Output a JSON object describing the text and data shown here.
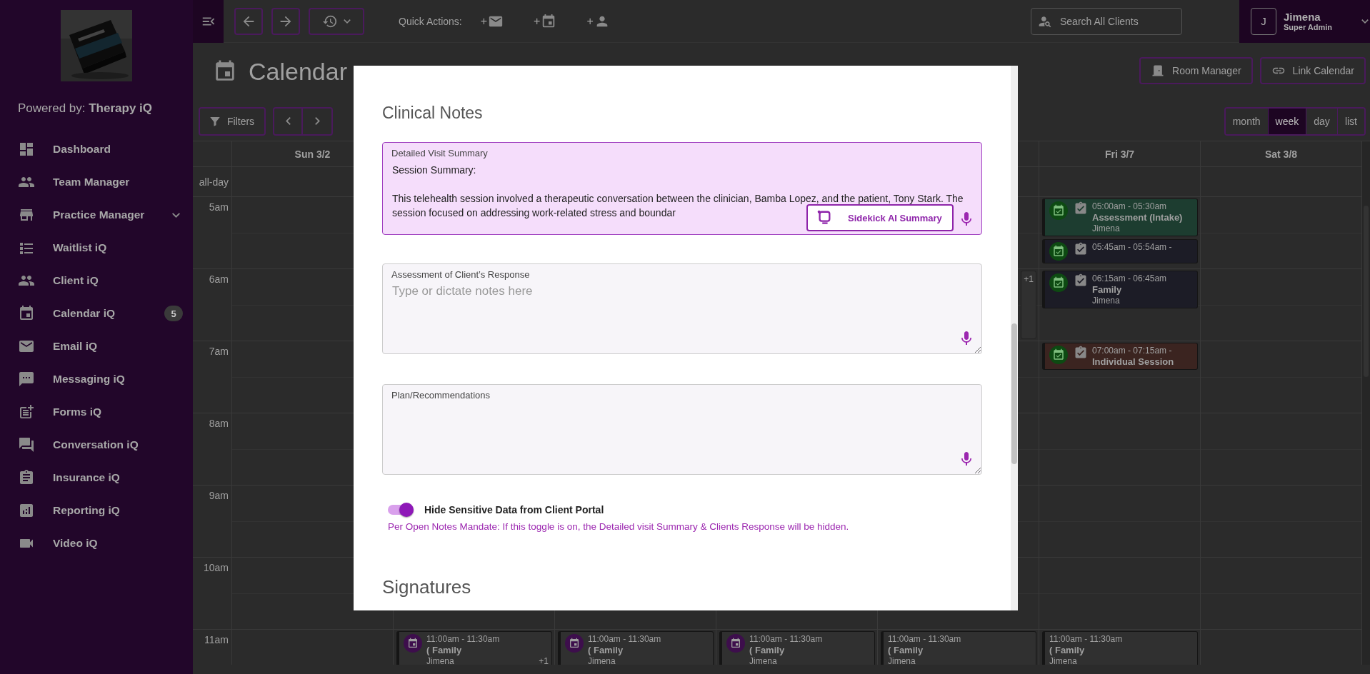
{
  "sidebar": {
    "powered_by": "Powered by: **Therapy iQ**",
    "items": [
      {
        "label": "Dashboard",
        "kind": "link"
      },
      {
        "label": "Team Manager",
        "kind": "link"
      },
      {
        "label": "Practice Manager",
        "kind": "group"
      },
      {
        "label": "Waitlist iQ",
        "kind": "link"
      },
      {
        "label": "Client iQ",
        "kind": "link"
      },
      {
        "label": "Calendar iQ",
        "kind": "link",
        "badge": "5"
      },
      {
        "label": "Email iQ",
        "kind": "link"
      },
      {
        "label": "Messaging iQ",
        "kind": "link"
      },
      {
        "label": "Forms iQ",
        "kind": "link"
      },
      {
        "label": "Conversation iQ",
        "kind": "link"
      },
      {
        "label": "Insurance iQ",
        "kind": "link"
      },
      {
        "label": "Reporting iQ",
        "kind": "link"
      },
      {
        "label": "Video iQ",
        "kind": "link"
      }
    ]
  },
  "topbar": {
    "quick_actions_label": "Quick Actions:",
    "quick_actions": [
      {
        "plus": "+",
        "kind": "email"
      },
      {
        "plus": "+",
        "kind": "event"
      },
      {
        "plus": "+",
        "kind": "client"
      }
    ],
    "search": {
      "placeholder": "Search All Clients"
    },
    "user": {
      "initial": "J",
      "name": "Jimena",
      "role": "Super Admin"
    }
  },
  "page_header": {
    "title": "Calendar",
    "buttons": [
      {
        "label": "Room Manager",
        "kind": "room"
      },
      {
        "label": "Link Calendar",
        "kind": "link"
      }
    ]
  },
  "toolbar": {
    "filters": "Filters",
    "views": [
      {
        "label": "month",
        "selected": false
      },
      {
        "label": "week",
        "selected": true
      },
      {
        "label": "day",
        "selected": false
      },
      {
        "label": "list",
        "selected": false
      }
    ]
  },
  "calendar": {
    "all_day_label": "all-day",
    "day_headers": [
      {
        "kind": "shown",
        "label": "Sun 3/2"
      },
      {
        "kind": "hidden"
      },
      {
        "kind": "hidden"
      },
      {
        "kind": "hidden"
      },
      {
        "kind": "hidden"
      },
      {
        "kind": "shown",
        "label": "Fri 3/7"
      },
      {
        "kind": "shown",
        "label": "Sat 3/8"
      }
    ],
    "rows": [
      {
        "time": "5am",
        "cells": [
          {},
          {},
          {},
          {},
          {},
          {
            "events": [
              {
                "kind": "confirmed",
                "time": "05:00am - 05:30am",
                "title": "Assessment (Intake)",
                "client": "Jimena",
                "color": "#1d3d30"
              },
              {
                "kind": "confirmed",
                "time": "05:45am - 05:54am -",
                "color": "#1c1c26"
              }
            ]
          },
          {}
        ]
      },
      {
        "time": "6am",
        "cells": [
          {},
          {},
          {},
          {},
          {
            "events": [
              {
                "kind": "more",
                "more": "+1"
              }
            ]
          },
          {
            "events": [
              {
                "kind": "confirmed",
                "time": "06:15am - 06:45am",
                "title": "Family",
                "client": "Jimena",
                "color": "#1c1c26"
              }
            ]
          },
          {}
        ]
      },
      {
        "time": "7am",
        "cells": [
          {},
          {},
          {},
          {},
          {},
          {
            "events": [
              {
                "kind": "confirmed",
                "time": "07:00am - 07:15am -",
                "title": "Individual Session",
                "color": "#3b2420"
              }
            ]
          },
          {}
        ]
      },
      {
        "time": "8am"
      },
      {
        "time": "9am"
      },
      {
        "time": "10am"
      },
      {
        "time": "11am",
        "cells": [
          {},
          {
            "events": [
              {
                "kind": "scheduled",
                "time": "11:00am - 11:30am",
                "title": "( Family",
                "client": "Jimena",
                "color": "#303030",
                "more": "+1"
              }
            ]
          },
          {
            "events": [
              {
                "kind": "scheduled",
                "time": "11:00am - 11:30am",
                "title": "( Family",
                "client": "Jimena",
                "color": "#303030"
              }
            ]
          },
          {
            "events": [
              {
                "kind": "scheduled",
                "time": "11:00am - 11:30am",
                "title": "( Family",
                "client": "Jimena",
                "color": "#303030"
              }
            ]
          },
          {
            "events": [
              {
                "kind": "plain",
                "time": "11:00am - 11:30am",
                "title": "( Family",
                "client": "Jimena",
                "color": "#303030"
              }
            ]
          },
          {
            "events": [
              {
                "kind": "plain",
                "time": "11:00am - 11:30am",
                "title": "( Family",
                "client": "Jimena",
                "color": "#303030"
              }
            ]
          },
          {}
        ]
      }
    ]
  },
  "modal": {
    "section_title": "Clinical Notes",
    "fields": [
      {
        "label": "Detailed Visit Summary",
        "value": "Session Summary:\n\nThis telehealth session involved a therapeutic conversation between the clinician, Bamba Lopez, and the patient, Tony Stark. The session focused on addressing work-related stress and boundar",
        "focused": true,
        "ai_button": "Sidekick AI Summary"
      },
      {
        "label": "Assessment of Client’s Response",
        "placeholder": "Type or dictate notes here",
        "focused": false
      },
      {
        "label": "Plan/Recommendations",
        "focused": false
      }
    ],
    "toggle": {
      "label": "Hide Sensitive Data from Client Portal",
      "on": true,
      "note": "Per Open Notes Mandate: If this toggle is on, the Detailed visit Summary & Clients Response will be hidden."
    },
    "next_section_title": "Signatures"
  }
}
